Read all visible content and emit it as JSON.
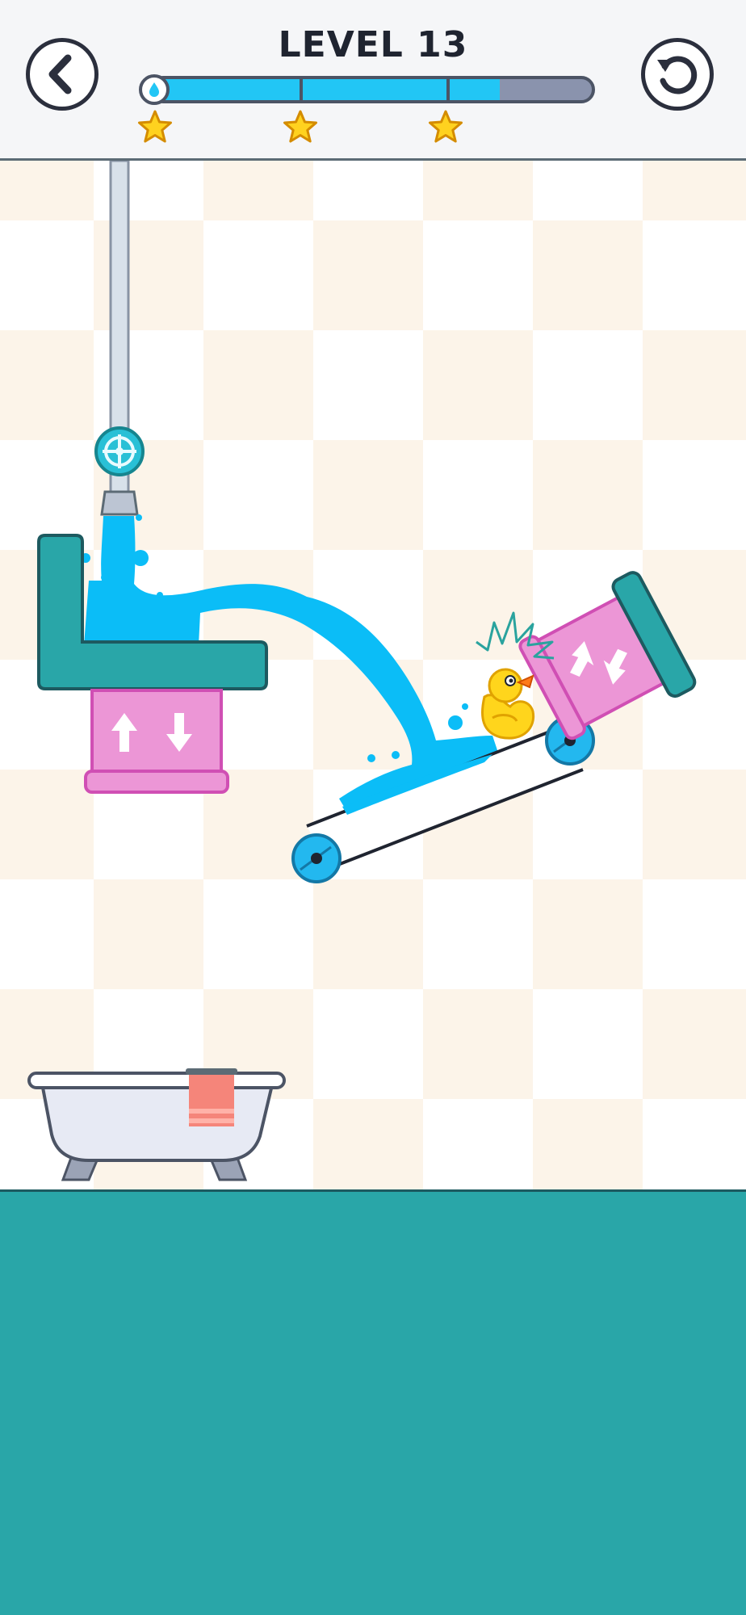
{
  "header": {
    "level_title": "LEVEL 13",
    "back_icon": "chevron-left-icon",
    "restart_icon": "restart-icon"
  },
  "progress": {
    "fill_fraction": 0.79,
    "stars_earned": 3,
    "stars_total": 3,
    "fill_color": "#22c6f5",
    "track_color": "#8a93ad"
  },
  "colors": {
    "tile_beige": "#fcf4e9",
    "tile_white": "#ffffff",
    "water": "#0bbdf7",
    "platform_teal": "#29a6a8",
    "piston_pink": "#ec96d6",
    "floor": "#29a6a8",
    "duck_yellow": "#ffd51c"
  },
  "scene": {
    "valve_icon": "valve-icon",
    "duck_icon": "rubber-duck-icon",
    "bathtub_icon": "bathtub-icon",
    "towel_icon": "towel-icon",
    "vertical_piston_arrows": "up-down-arrows-icon",
    "tilted_piston_arrows": "diagonal-arrows-icon"
  }
}
